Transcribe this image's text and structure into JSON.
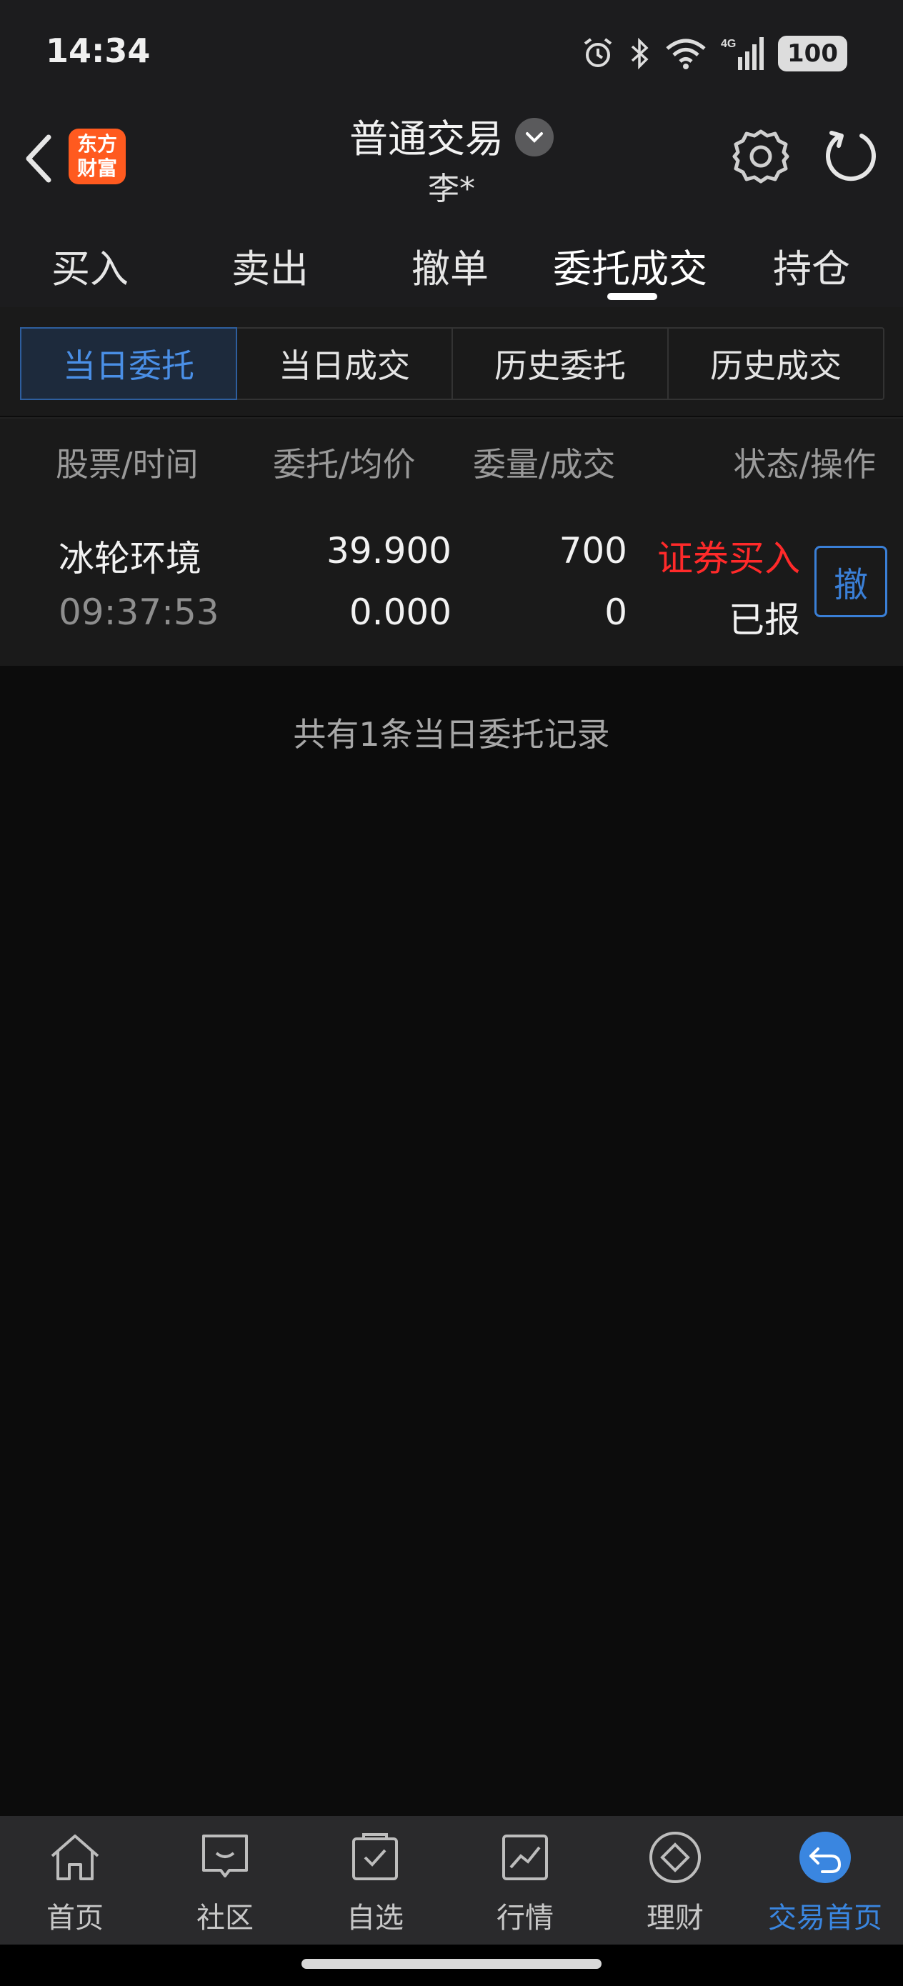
{
  "status_bar": {
    "time": "14:34",
    "battery": "100",
    "network": "4G"
  },
  "header": {
    "title": "普通交易",
    "account": "李*",
    "logo_text": "东方财富"
  },
  "main_tabs": [
    "买入",
    "卖出",
    "撤单",
    "委托成交",
    "持仓"
  ],
  "active_main_tab": "委托成交",
  "sub_tabs": [
    "当日委托",
    "当日成交",
    "历史委托",
    "历史成交"
  ],
  "active_sub_tab": "当日委托",
  "table": {
    "headers": [
      "股票/时间",
      "委托/均价",
      "委量/成交",
      "状态/操作"
    ],
    "rows": [
      {
        "name": "冰轮环境",
        "time": "09:37:53",
        "order_price": "39.900",
        "avg_price": "0.000",
        "order_qty": "700",
        "filled_qty": "0",
        "type": "证券买入",
        "status": "已报",
        "action": "撤"
      }
    ]
  },
  "summary": "共有1条当日委托记录",
  "bottom_nav": [
    {
      "label": "首页",
      "icon": "home-icon"
    },
    {
      "label": "社区",
      "icon": "community-icon"
    },
    {
      "label": "自选",
      "icon": "watchlist-icon"
    },
    {
      "label": "行情",
      "icon": "market-chart-icon"
    },
    {
      "label": "理财",
      "icon": "finance-diamond-icon"
    },
    {
      "label": "交易首页",
      "icon": "trade-home-icon"
    }
  ],
  "colors": {
    "accent": "#3a86e0",
    "buy_red": "#ff2a2a",
    "logo_orange": "#ff5a1f"
  }
}
